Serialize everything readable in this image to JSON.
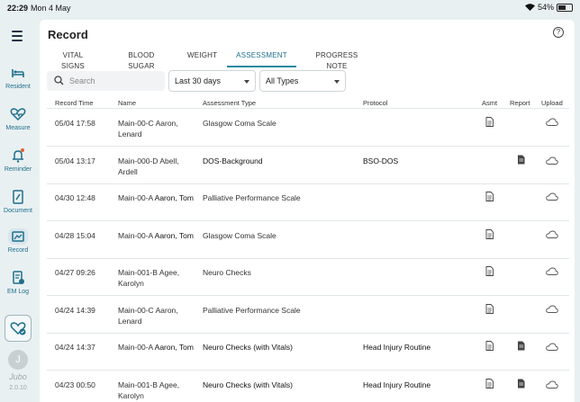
{
  "status_bar": {
    "time": "22:29",
    "date": "Mon 4 May",
    "battery": "54%"
  },
  "sidebar": {
    "items": [
      {
        "label": "Resident",
        "icon": "bed-icon"
      },
      {
        "label": "Measure",
        "icon": "heart-pulse-icon"
      },
      {
        "label": "Reminder",
        "icon": "bell-icon"
      },
      {
        "label": "Document",
        "icon": "document-edit-icon"
      },
      {
        "label": "Record",
        "icon": "record-icon",
        "active": true
      },
      {
        "label": "EM Log",
        "icon": "em-log-icon"
      }
    ],
    "avatar_initial": "J",
    "brand": "Jubo",
    "version": "2.0.10"
  },
  "page": {
    "title": "Record"
  },
  "tabs": [
    {
      "label": "VITAL SIGNS"
    },
    {
      "label": "BLOOD SUGAR"
    },
    {
      "label": "WEIGHT"
    },
    {
      "label": "ASSESSMENT",
      "active": true
    },
    {
      "label": "PROGRESS NOTE"
    }
  ],
  "filters": {
    "search_placeholder": "Search",
    "search_value": "",
    "range": "Last 30 days",
    "type": "All Types"
  },
  "table": {
    "headers": {
      "record_time": "Record Time",
      "name": "Name",
      "assessment_type": "Assessment Type",
      "protocol": "Protocol",
      "asmt": "Asmt",
      "report": "Report",
      "upload": "Upload"
    },
    "rows": [
      {
        "time": "05/04 17:58",
        "room": "Main-00-C",
        "name": "Aaron,",
        "name2": "Lenard",
        "type": "Glasgow Coma Scale",
        "protocol": "",
        "asmt": true,
        "report": false
      },
      {
        "time": "05/04 13:17",
        "room": "Main-000-D",
        "name": "Abell,",
        "name2": "Ardell",
        "type": "DOS-Background",
        "protocol": "BSO-DOS",
        "asmt": false,
        "report": true
      },
      {
        "time": "04/30 12:48",
        "room": "Main-00-A",
        "name": "Aaron, Tom",
        "name2": "",
        "type": "Palliative Performance Scale",
        "protocol": "",
        "asmt": true,
        "report": false
      },
      {
        "time": "04/28 15:04",
        "room": "Main-00-A",
        "name": "Aaron, Tom",
        "name2": "",
        "type": "Glasgow Coma Scale",
        "protocol": "",
        "asmt": true,
        "report": false
      },
      {
        "time": "04/27 09:26",
        "room": "Main-001-B",
        "name": "Agee,",
        "name2": "Karolyn",
        "type": "Neuro Checks",
        "protocol": "",
        "asmt": true,
        "report": false
      },
      {
        "time": "04/24 14:39",
        "room": "Main-00-C",
        "name": "Aaron,",
        "name2": "Lenard",
        "type": "Palliative Performance Scale",
        "protocol": "",
        "asmt": true,
        "report": false
      },
      {
        "time": "04/24 14:37",
        "room": "Main-00-A",
        "name": "Aaron, Tom",
        "name2": "",
        "type": "Neuro Checks (with Vitals)",
        "protocol": "Head Injury Routine",
        "asmt": true,
        "report": true
      },
      {
        "time": "04/23 00:50",
        "room": "Main-001-B",
        "name": "Agee,",
        "name2": "Karolyn",
        "type": "Neuro Checks (with Vitals)",
        "protocol": "Head Injury Routine",
        "asmt": true,
        "report": true
      }
    ]
  },
  "colors": {
    "accent": "#1f8aa0",
    "sidebar_text": "#1f6f8b",
    "background": "#e9f0f2"
  }
}
